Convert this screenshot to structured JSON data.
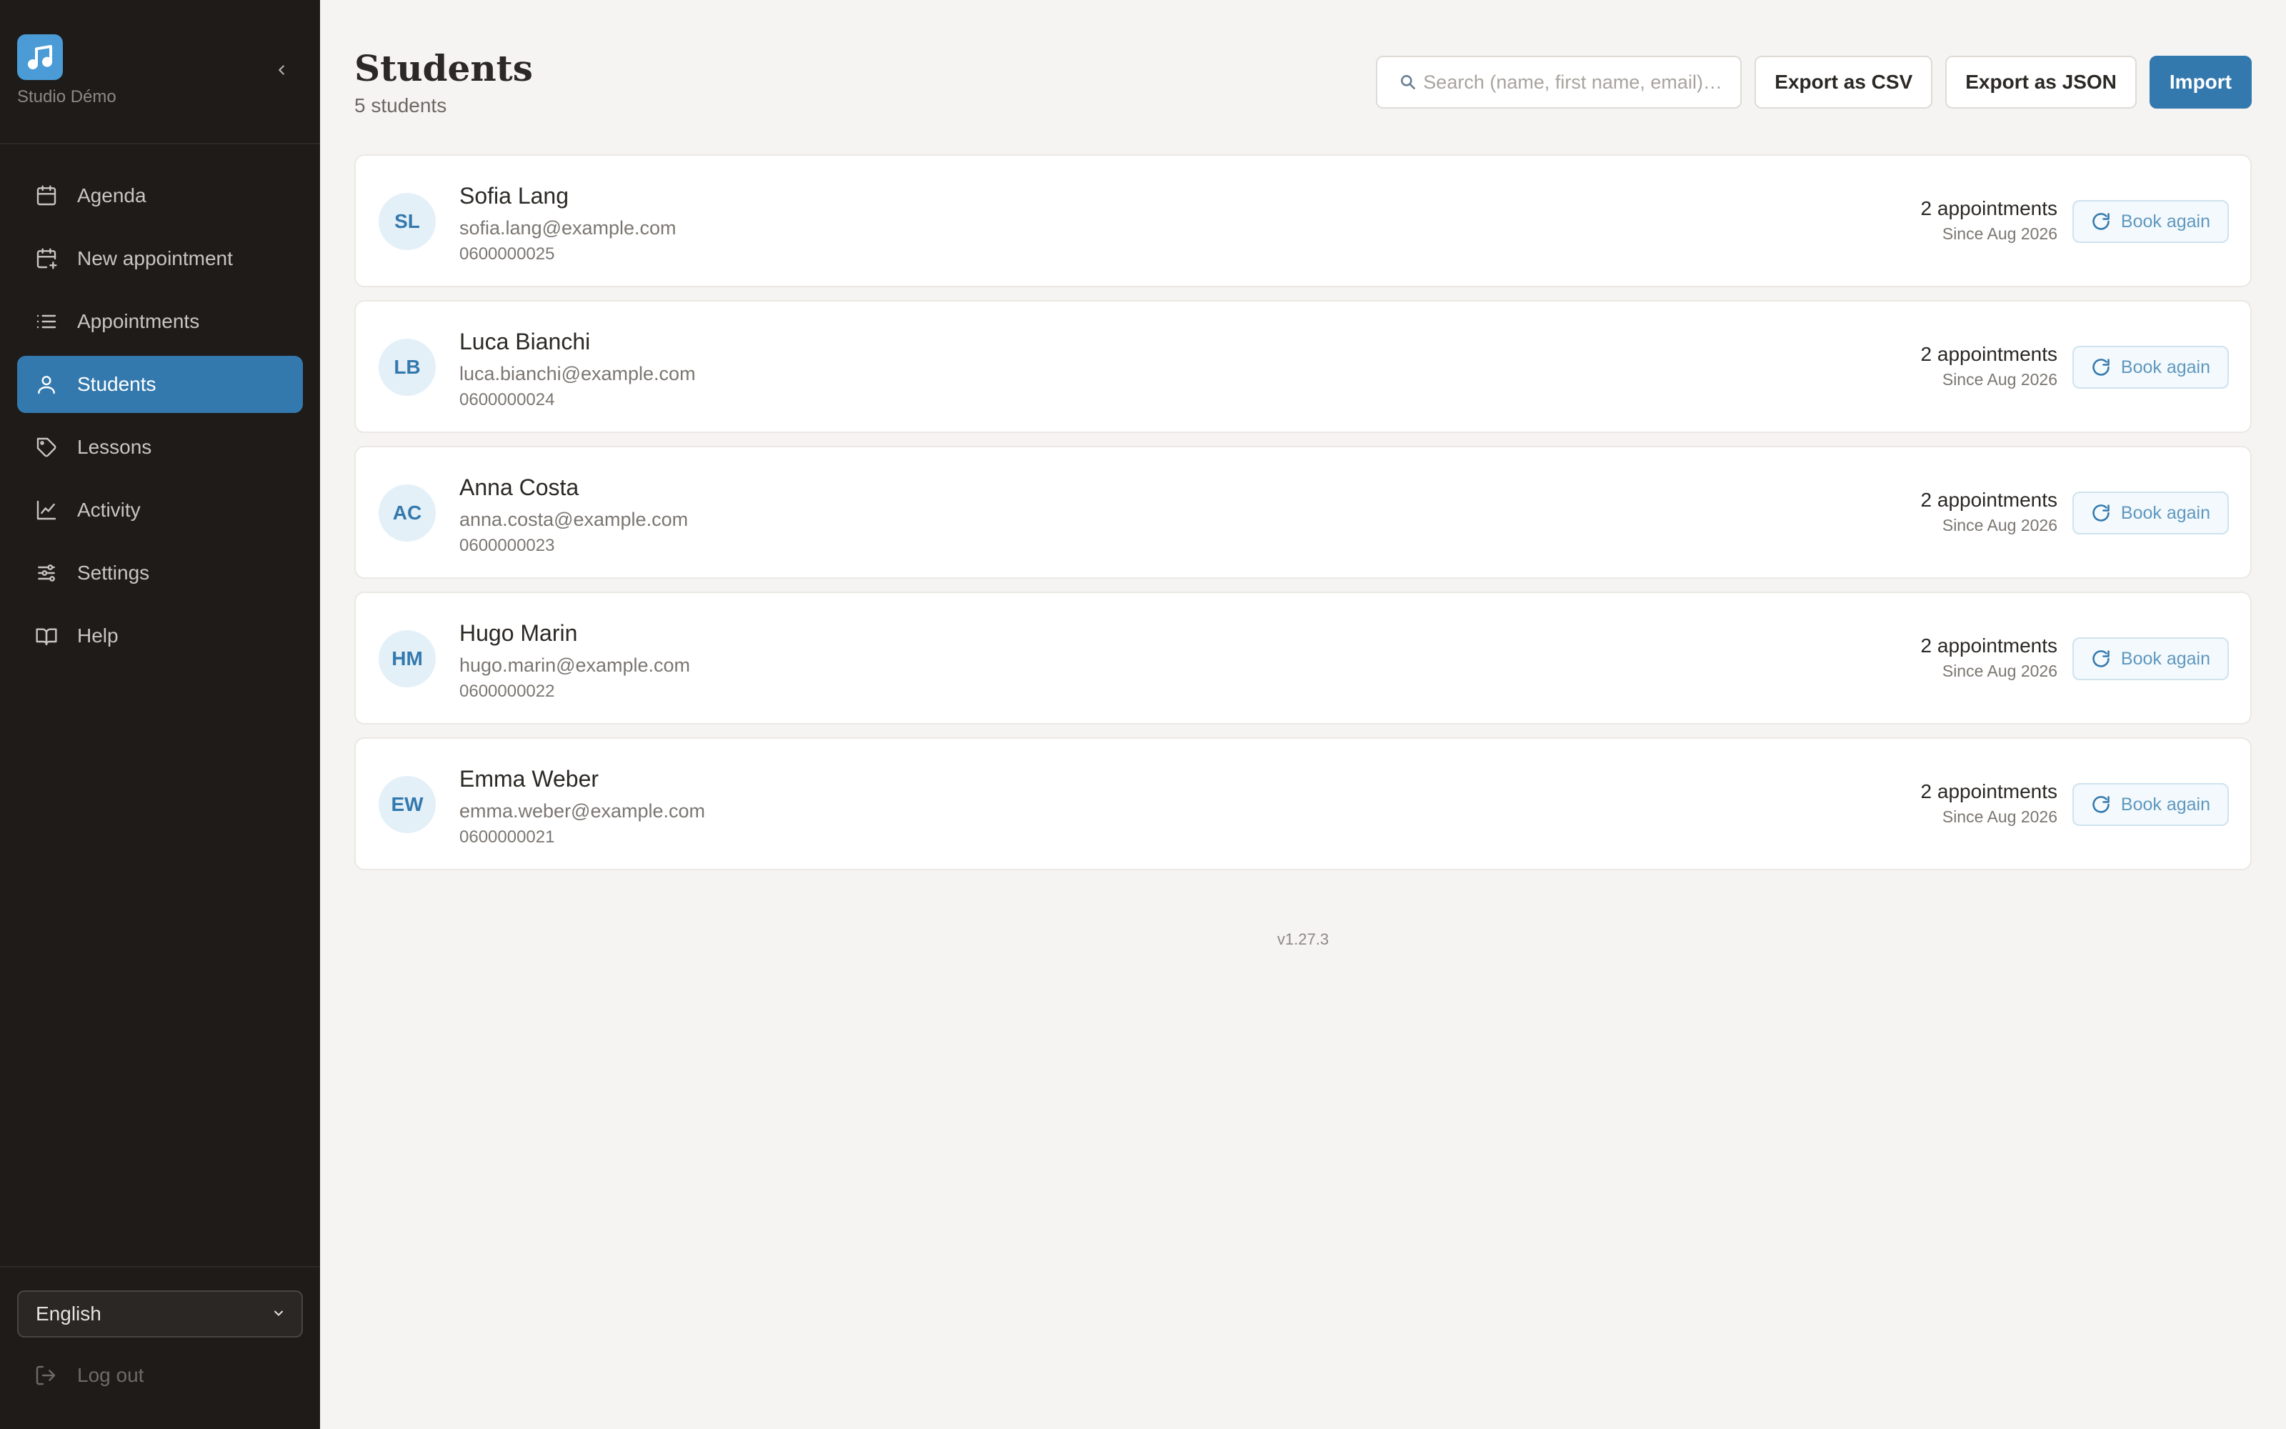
{
  "brand": {
    "name": "Studio Démo",
    "logo_icon": "music-note-icon",
    "accent": "#4a9bd6"
  },
  "sidebar": {
    "items": [
      {
        "label": "Agenda",
        "icon": "calendar-icon",
        "active": false
      },
      {
        "label": "New appointment",
        "icon": "calendar-plus-icon",
        "active": false
      },
      {
        "label": "Appointments",
        "icon": "list-icon",
        "active": false
      },
      {
        "label": "Students",
        "icon": "user-icon",
        "active": true
      },
      {
        "label": "Lessons",
        "icon": "tag-icon",
        "active": false
      },
      {
        "label": "Activity",
        "icon": "chart-line-icon",
        "active": false
      },
      {
        "label": "Settings",
        "icon": "sliders-icon",
        "active": false
      },
      {
        "label": "Help",
        "icon": "book-icon",
        "active": false
      }
    ],
    "language": "English",
    "logout_label": "Log out"
  },
  "page": {
    "title": "Students",
    "subtitle": "5 students"
  },
  "toolbar": {
    "search_placeholder": "Search (name, first name, email)…",
    "export_csv": "Export as CSV",
    "export_json": "Export as JSON",
    "import": "Import"
  },
  "students": [
    {
      "initials": "SL",
      "name": "Sofia Lang",
      "email": "sofia.lang@example.com",
      "phone": "0600000025",
      "appointments": "2 appointments",
      "since": "Since Aug 2026",
      "action": "Book again"
    },
    {
      "initials": "LB",
      "name": "Luca Bianchi",
      "email": "luca.bianchi@example.com",
      "phone": "0600000024",
      "appointments": "2 appointments",
      "since": "Since Aug 2026",
      "action": "Book again"
    },
    {
      "initials": "AC",
      "name": "Anna Costa",
      "email": "anna.costa@example.com",
      "phone": "0600000023",
      "appointments": "2 appointments",
      "since": "Since Aug 2026",
      "action": "Book again"
    },
    {
      "initials": "HM",
      "name": "Hugo Marin",
      "email": "hugo.marin@example.com",
      "phone": "0600000022",
      "appointments": "2 appointments",
      "since": "Since Aug 2026",
      "action": "Book again"
    },
    {
      "initials": "EW",
      "name": "Emma Weber",
      "email": "emma.weber@example.com",
      "phone": "0600000021",
      "appointments": "2 appointments",
      "since": "Since Aug 2026",
      "action": "Book again"
    }
  ],
  "footer": {
    "version": "v1.27.3"
  },
  "colors": {
    "primary": "#3479ae",
    "sidebar_bg": "#1e1b19",
    "page_bg": "#f5f4f2"
  }
}
